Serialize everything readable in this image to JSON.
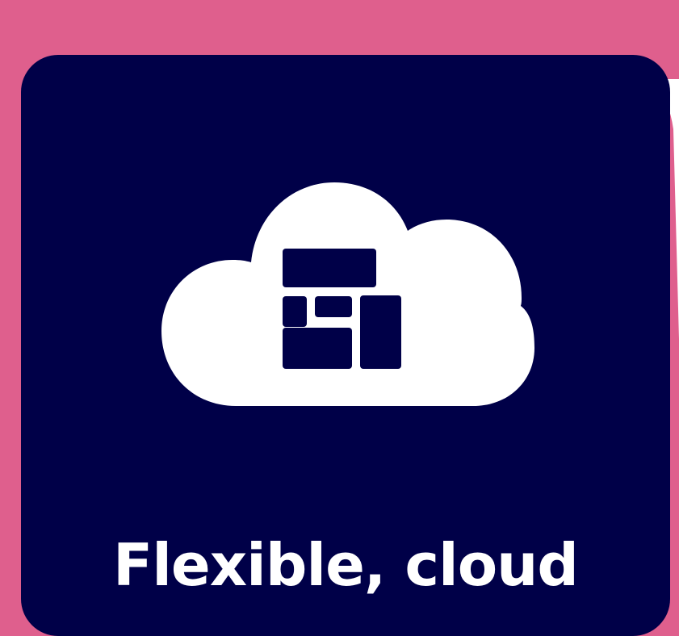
{
  "card": {
    "icon": "cloud-grid-icon",
    "title": "Flexible, cloud"
  },
  "colors": {
    "page_background": "#df5f8d",
    "card_background": "#000048",
    "icon_color": "#ffffff",
    "title_color": "#ffffff"
  }
}
